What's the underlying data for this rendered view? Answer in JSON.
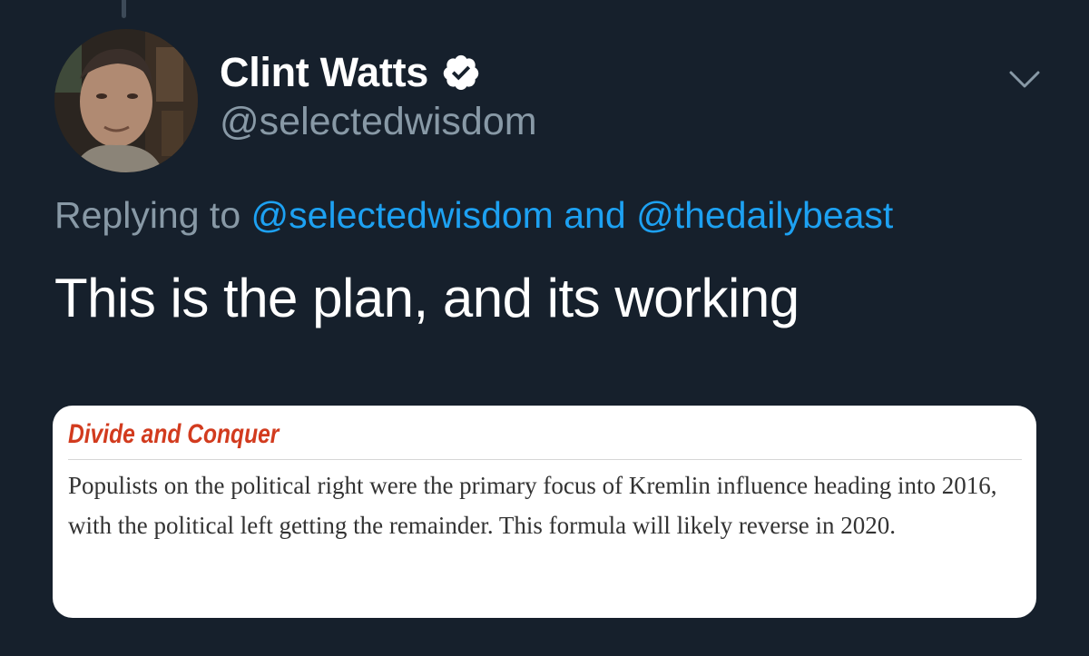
{
  "author": {
    "display_name": "Clint Watts",
    "handle": "@selectedwisdom",
    "verified": true
  },
  "reply": {
    "prefix": "Replying to",
    "mention_1": "@selectedwisdom",
    "conjunction": "and",
    "mention_2": "@thedailybeast"
  },
  "tweet": {
    "text": "This is the plan, and its working"
  },
  "quote_image": {
    "heading": "Divide and Conquer",
    "body": "Populists on the political right were the primary focus of Kremlin influence heading into 2016, with the political left getting the remainder. This formula will likely reverse in 2020."
  },
  "icons": {
    "verified": "verified-badge-icon",
    "menu": "chevron-down-icon"
  },
  "colors": {
    "background": "#16202c",
    "link": "#1da1f2",
    "secondary_text": "#8899a6",
    "heading_red": "#d23b1e"
  }
}
